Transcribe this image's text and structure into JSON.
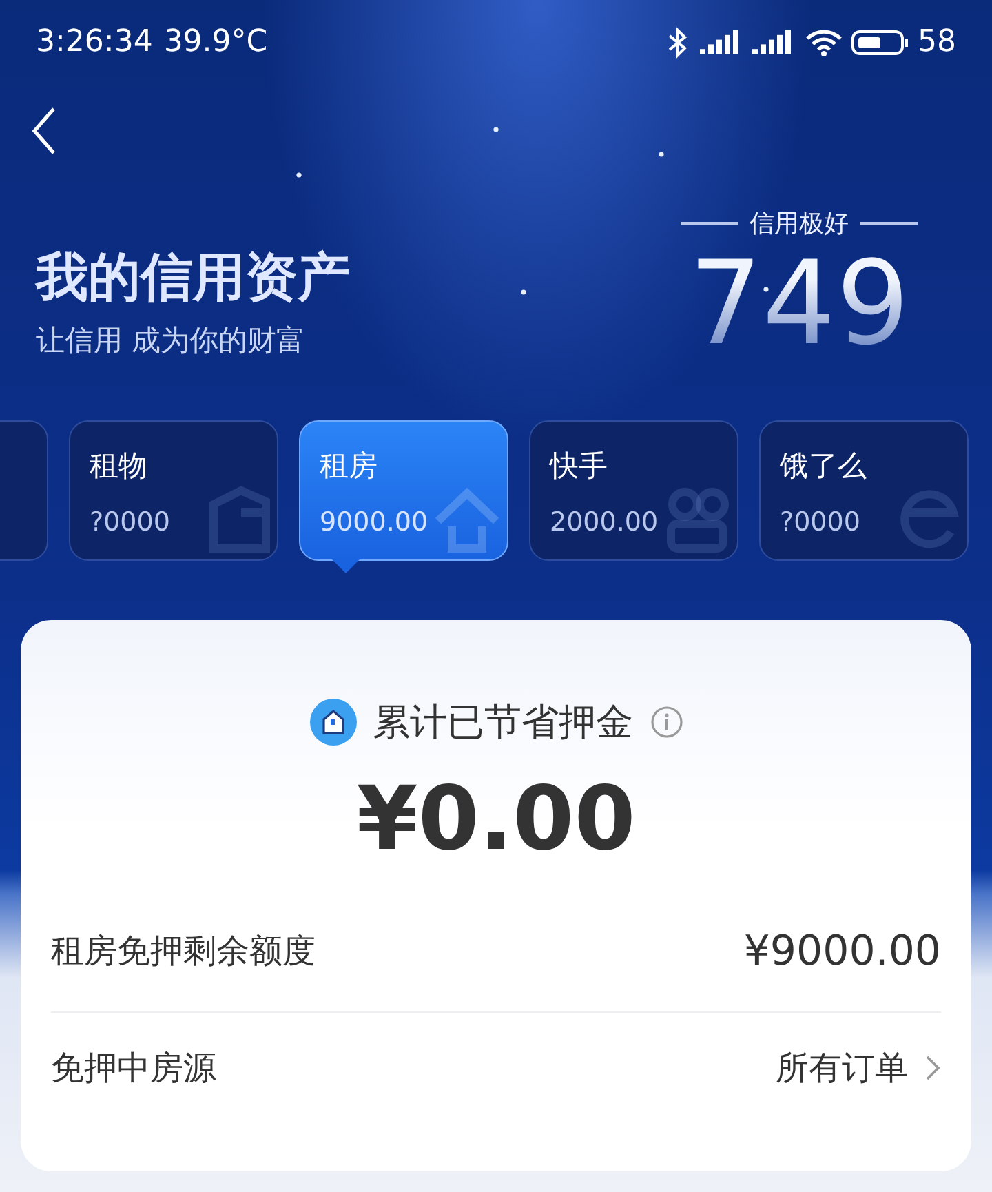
{
  "status_bar": {
    "time": "3:26:34",
    "temperature": "39.9°C",
    "battery": "58"
  },
  "header": {
    "title": "我的信用资产",
    "subtitle": "让信用 成为你的财富",
    "score_label": "信用极好",
    "score": "749"
  },
  "cards": [
    {
      "name": "租物",
      "amount": "?0000",
      "selected": false
    },
    {
      "name": "租房",
      "amount": "9000.00",
      "selected": true
    },
    {
      "name": "快手",
      "amount": "2000.00",
      "selected": false
    },
    {
      "name": "饿了么",
      "amount": "?0000",
      "selected": false
    }
  ],
  "summary": {
    "title": "累计已节省押金",
    "amount": "¥0.00"
  },
  "rows": [
    {
      "label": "租房免押剩余额度",
      "value": "¥9000.00",
      "kind": "value"
    },
    {
      "label": "免押中房源",
      "value": "所有订单",
      "kind": "link"
    }
  ]
}
